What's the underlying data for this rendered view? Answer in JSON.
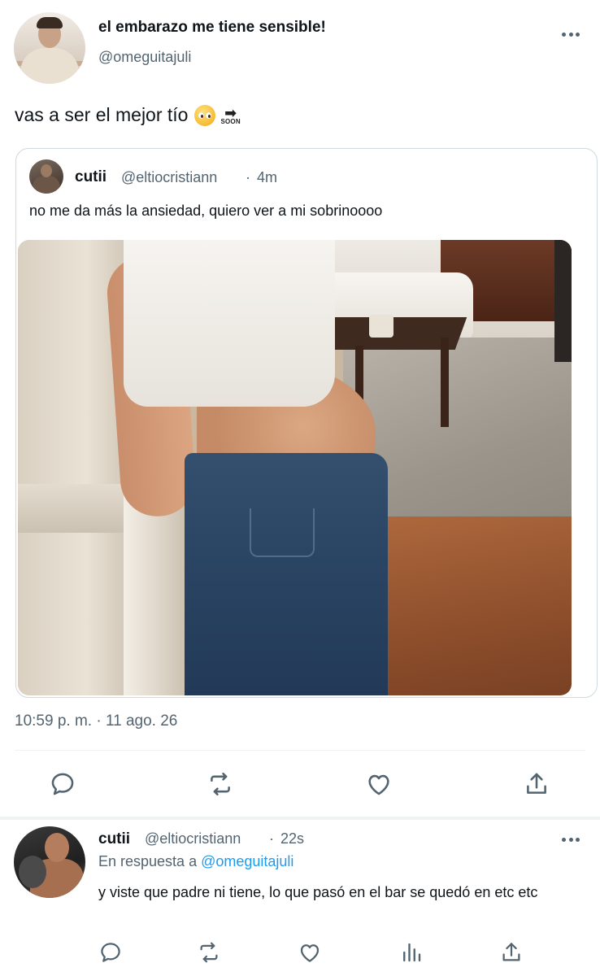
{
  "main_tweet": {
    "display_name": "el embarazo me tiene sensible!",
    "handle": "@omeguitajuli",
    "text": "vas a ser el mejor tío",
    "emoji_1": "pleading-face-emoji",
    "emoji_2_label": "SOON",
    "timestamp": "10:59 p. m. · 11 ago. 26"
  },
  "quoted_tweet": {
    "display_name": "cutii",
    "handle": "@eltiocristiann",
    "separator": "·",
    "time": "4m",
    "text": "no me da más la ansiedad, quiero ver a mi sobrinoooo",
    "photo": "photo-pregnant-belly-in-jeans"
  },
  "reply_tweet": {
    "display_name": "cutii",
    "handle": "@eltiocristiann",
    "separator": "·",
    "time": "22s",
    "replying_to_prefix": "En respuesta a",
    "replying_to_handle": "@omeguitajuli",
    "text": "y viste que padre ni tiene, lo que pasó en el bar se quedó en etc etc"
  },
  "icons": {
    "reply": "reply-icon",
    "retweet": "retweet-icon",
    "like": "heart-icon",
    "share": "share-icon",
    "views": "views-icon",
    "more": "more-icon"
  },
  "colors": {
    "text": "#0f1419",
    "secondary": "#536471",
    "link": "#1d9bf0",
    "border": "#cfd9de"
  }
}
